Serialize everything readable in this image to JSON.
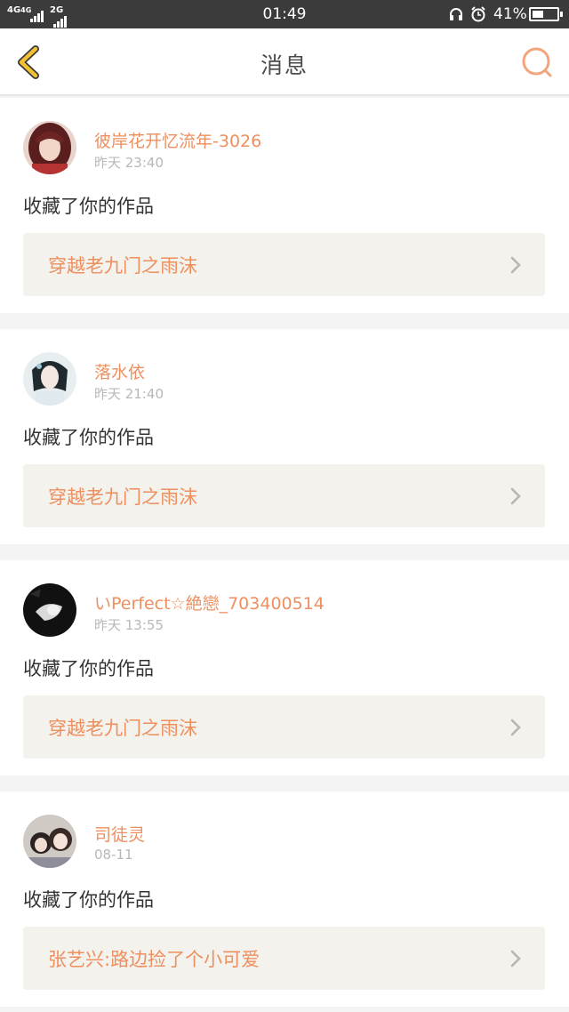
{
  "status_bar": {
    "signal_1": "4G",
    "signal_2": "4G",
    "signal_3": "2G",
    "time": "01:49",
    "battery": "41%",
    "icons": [
      "headphone-icon",
      "alarm-icon",
      "battery-icon"
    ]
  },
  "header": {
    "title": "消息",
    "back_icon": "chevron-left-icon",
    "search_icon": "search-icon"
  },
  "colors": {
    "accent": "#ee8f5f",
    "back_icon": "#f2c033",
    "work_box_bg": "#f3f2ed"
  },
  "messages": [
    {
      "username": "彼岸花开忆流年-3026",
      "time": "昨天 23:40",
      "action": "收藏了你的作品",
      "work_title": "穿越老九门之雨沫"
    },
    {
      "username": "落水依",
      "time": "昨天 21:40",
      "action": "收藏了你的作品",
      "work_title": "穿越老九门之雨沫"
    },
    {
      "username": "いPerfect☆絶戀_703400514",
      "time": "昨天 13:55",
      "action": "收藏了你的作品",
      "work_title": "穿越老九门之雨沫"
    },
    {
      "username": "司徒灵",
      "time": "08-11",
      "action": "收藏了你的作品",
      "work_title": "张艺兴:路边捡了个小可爱"
    }
  ]
}
